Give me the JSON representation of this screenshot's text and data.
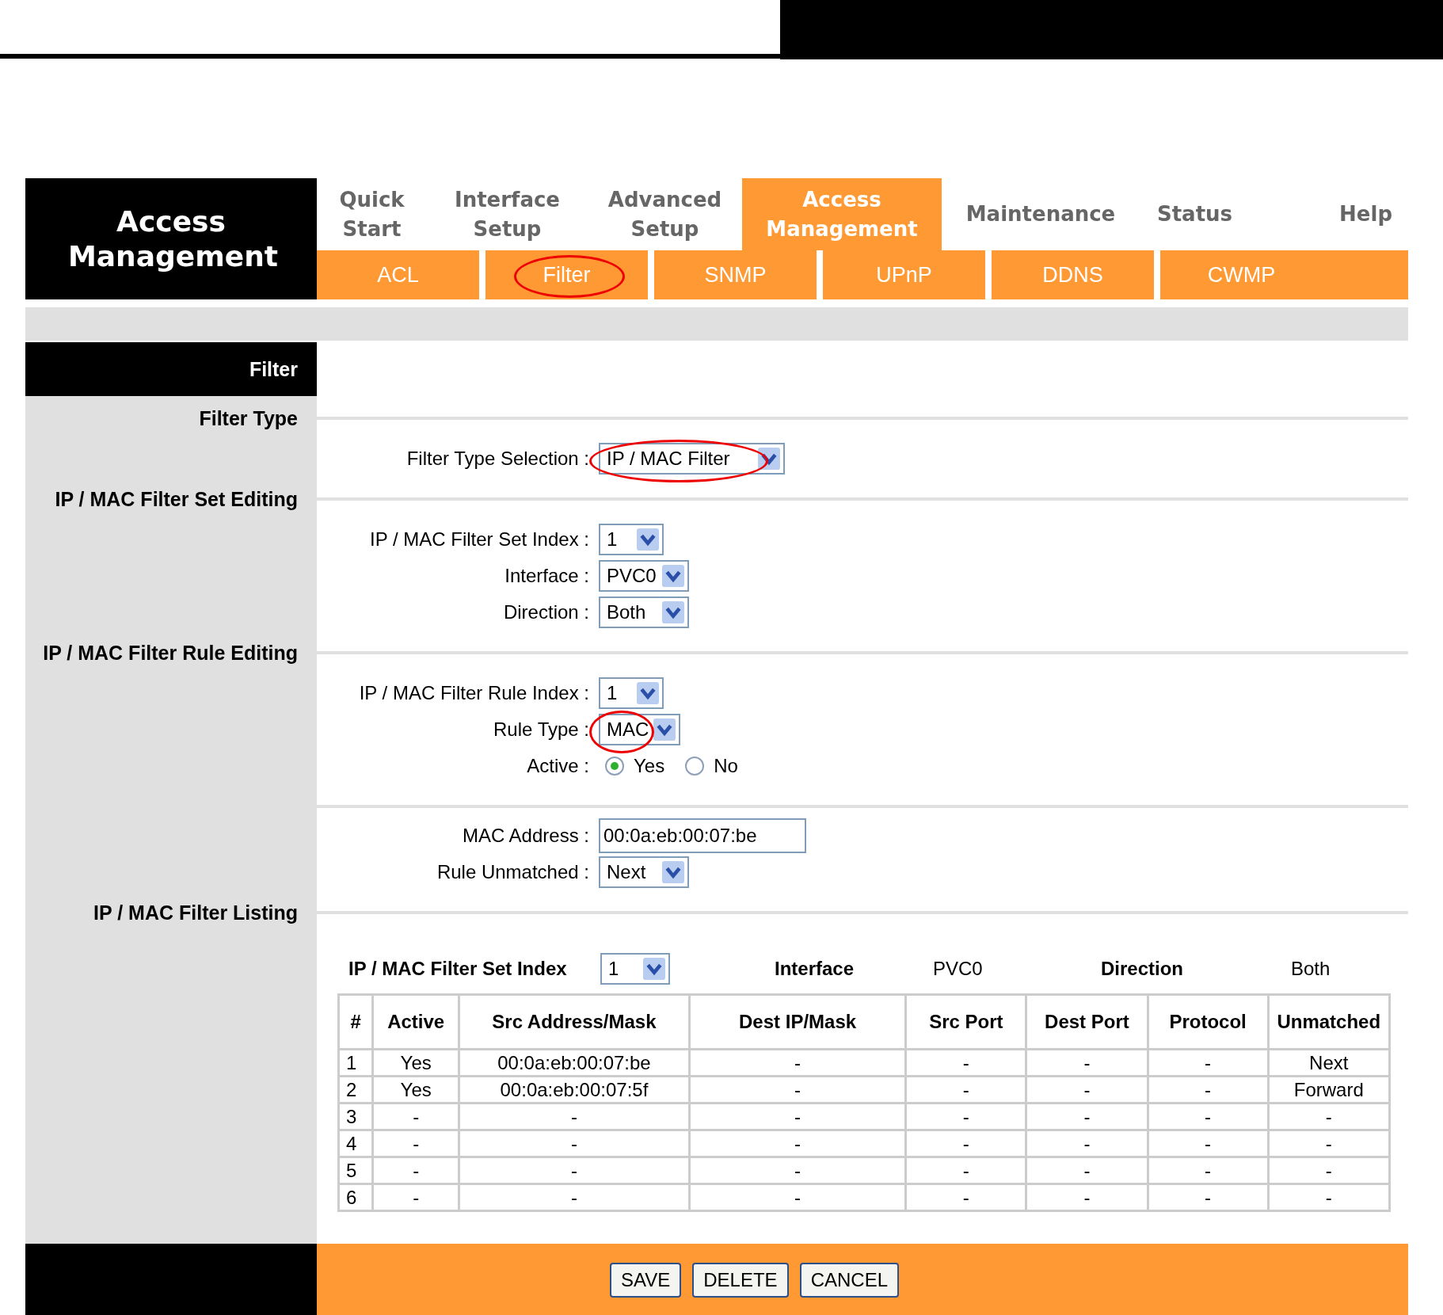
{
  "section_title": "Access Management",
  "tabs": [
    {
      "label": "Quick Start",
      "selected": false
    },
    {
      "label": "Interface Setup",
      "selected": false
    },
    {
      "label": "Advanced Setup",
      "selected": false
    },
    {
      "label": "Access Management",
      "selected": true
    },
    {
      "label": "Maintenance",
      "selected": false
    },
    {
      "label": "Status",
      "selected": false
    },
    {
      "label": "Help",
      "selected": false
    }
  ],
  "subtabs": [
    {
      "label": "ACL",
      "circled": false
    },
    {
      "label": "Filter",
      "circled": true
    },
    {
      "label": "SNMP",
      "circled": false
    },
    {
      "label": "UPnP",
      "circled": false
    },
    {
      "label": "DDNS",
      "circled": false
    },
    {
      "label": "CWMP",
      "circled": false
    }
  ],
  "panel_title": "Filter",
  "sections": [
    {
      "title": "Filter Type",
      "groups": [
        [
          {
            "kind": "select",
            "label": "Filter Type Selection :",
            "value": "IP / MAC Filter",
            "circled": true
          }
        ]
      ]
    },
    {
      "title": "IP / MAC Filter Set Editing",
      "groups": [
        [
          {
            "kind": "select",
            "label": "IP / MAC Filter Set Index :",
            "value": "1",
            "circled": false
          },
          {
            "kind": "select",
            "label": "Interface :",
            "value": "PVC0",
            "circled": false
          },
          {
            "kind": "select",
            "label": "Direction :",
            "value": "Both",
            "circled": false
          }
        ]
      ]
    },
    {
      "title": "IP / MAC Filter Rule Editing",
      "groups": [
        [
          {
            "kind": "select",
            "label": "IP / MAC Filter Rule Index :",
            "value": "1",
            "circled": false
          },
          {
            "kind": "select",
            "label": "Rule Type :",
            "value": "MAC",
            "circled": true
          },
          {
            "kind": "radio",
            "label": "Active :",
            "options": [
              {
                "label": "Yes",
                "selected": true
              },
              {
                "label": "No",
                "selected": false
              }
            ]
          }
        ],
        [
          {
            "kind": "text",
            "label": "MAC Address :",
            "value": "00:0a:eb:00:07:be"
          },
          {
            "kind": "select",
            "label": "Rule Unmatched :",
            "value": "Next",
            "circled": false
          }
        ]
      ]
    }
  ],
  "listing": {
    "title": "IP / MAC Filter Listing",
    "set_index_label": "IP / MAC Filter Set Index",
    "set_index_value": "1",
    "interface_label": "Interface",
    "interface_value": "PVC0",
    "direction_label": "Direction",
    "direction_value": "Both",
    "columns": [
      "#",
      "Active",
      "Src Address/Mask",
      "Dest IP/Mask",
      "Src Port",
      "Dest Port",
      "Protocol",
      "Unmatched"
    ],
    "rows": [
      [
        "1",
        "Yes",
        "00:0a:eb:00:07:be",
        "-",
        "-",
        "-",
        "-",
        "Next"
      ],
      [
        "2",
        "Yes",
        "00:0a:eb:00:07:5f",
        "-",
        "-",
        "-",
        "-",
        "Forward"
      ],
      [
        "3",
        "-",
        "-",
        "-",
        "-",
        "-",
        "-",
        "-"
      ],
      [
        "4",
        "-",
        "-",
        "-",
        "-",
        "-",
        "-",
        "-"
      ],
      [
        "5",
        "-",
        "-",
        "-",
        "-",
        "-",
        "-",
        "-"
      ],
      [
        "6",
        "-",
        "-",
        "-",
        "-",
        "-",
        "-",
        "-"
      ]
    ]
  },
  "buttons": [
    "SAVE",
    "DELETE",
    "CANCEL"
  ]
}
